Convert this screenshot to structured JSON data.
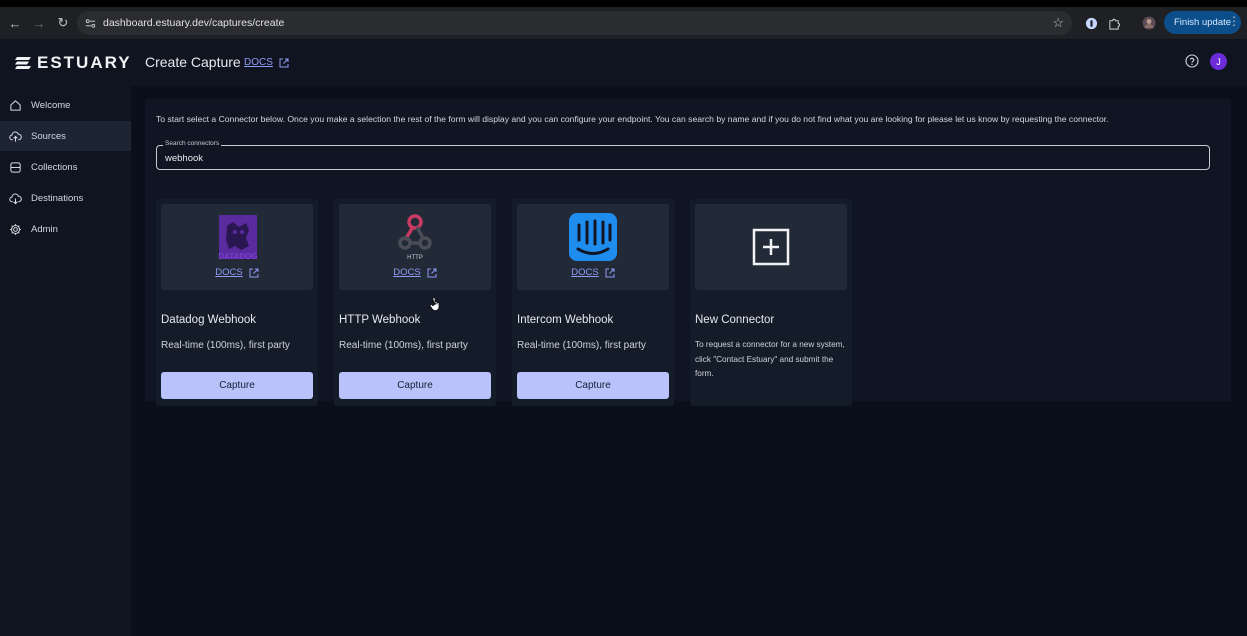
{
  "browser": {
    "url": "dashboard.estuary.dev/captures/create",
    "finish_update_label": "Finish update"
  },
  "header": {
    "logo_text": "ESTUARY",
    "page_title": "Create Capture",
    "docs_label": "DOCS",
    "avatar_initial": "J"
  },
  "sidebar": {
    "items": [
      {
        "label": "Welcome",
        "icon": "home-icon"
      },
      {
        "label": "Sources",
        "icon": "cloud-upload-icon"
      },
      {
        "label": "Collections",
        "icon": "database-icon"
      },
      {
        "label": "Destinations",
        "icon": "cloud-download-icon"
      },
      {
        "label": "Admin",
        "icon": "gear-icon"
      }
    ],
    "active": "Sources"
  },
  "main": {
    "intro": "To start select a Connector below. Once you make a selection the rest of the form will display and you can configure your endpoint. You can search by name and if you do not find what you are looking for please let us know by requesting the connector.",
    "search": {
      "label": "Search connectors",
      "value": "webhook"
    },
    "cards": [
      {
        "title": "Datadog Webhook",
        "description": "Real-time (100ms), first party",
        "docs": "DOCS",
        "button": "Capture",
        "logo_text": "DATADOG"
      },
      {
        "title": "HTTP Webhook",
        "description": "Real-time (100ms), first party",
        "docs": "DOCS",
        "button": "Capture",
        "logo_text": "HTTP"
      },
      {
        "title": "Intercom Webhook",
        "description": "Real-time (100ms), first party",
        "docs": "DOCS",
        "button": "Capture"
      },
      {
        "title": "New Connector",
        "description": "To request a connector for a new system, click \"Contact Estuary\" and submit the form."
      }
    ]
  },
  "colors": {
    "accent": "#b9c2fb",
    "link": "#8f9bf5",
    "avatar": "#6b2bd9",
    "update_button": "#0b4e8a"
  }
}
